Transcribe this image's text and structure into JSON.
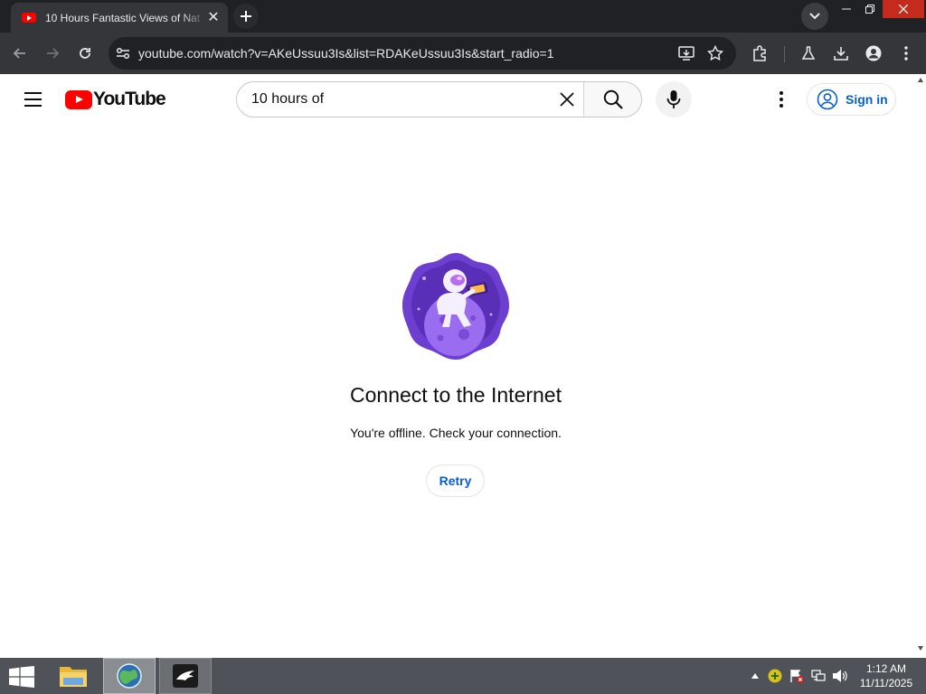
{
  "browser": {
    "tab_title": "10 Hours Fantastic Views of Nat",
    "tab_close": "✕",
    "url": "youtube.com/watch?v=AKeUssuu3Is&list=RDAKeUssuu3Is&start_radio=1"
  },
  "youtube": {
    "logo_text": "YouTube",
    "search": {
      "value": "10 hours of",
      "placeholder": "Search"
    },
    "signin_label": "Sign in"
  },
  "offline": {
    "title": "Connect to the Internet",
    "message": "You're offline. Check your connection.",
    "retry_label": "Retry"
  },
  "taskbar": {
    "time": "1:12 AM",
    "date": "11/11/2025"
  },
  "colors": {
    "yt_red": "#ff0000",
    "link_blue": "#065fd4",
    "illustration_purple": "#6c3fd1"
  }
}
